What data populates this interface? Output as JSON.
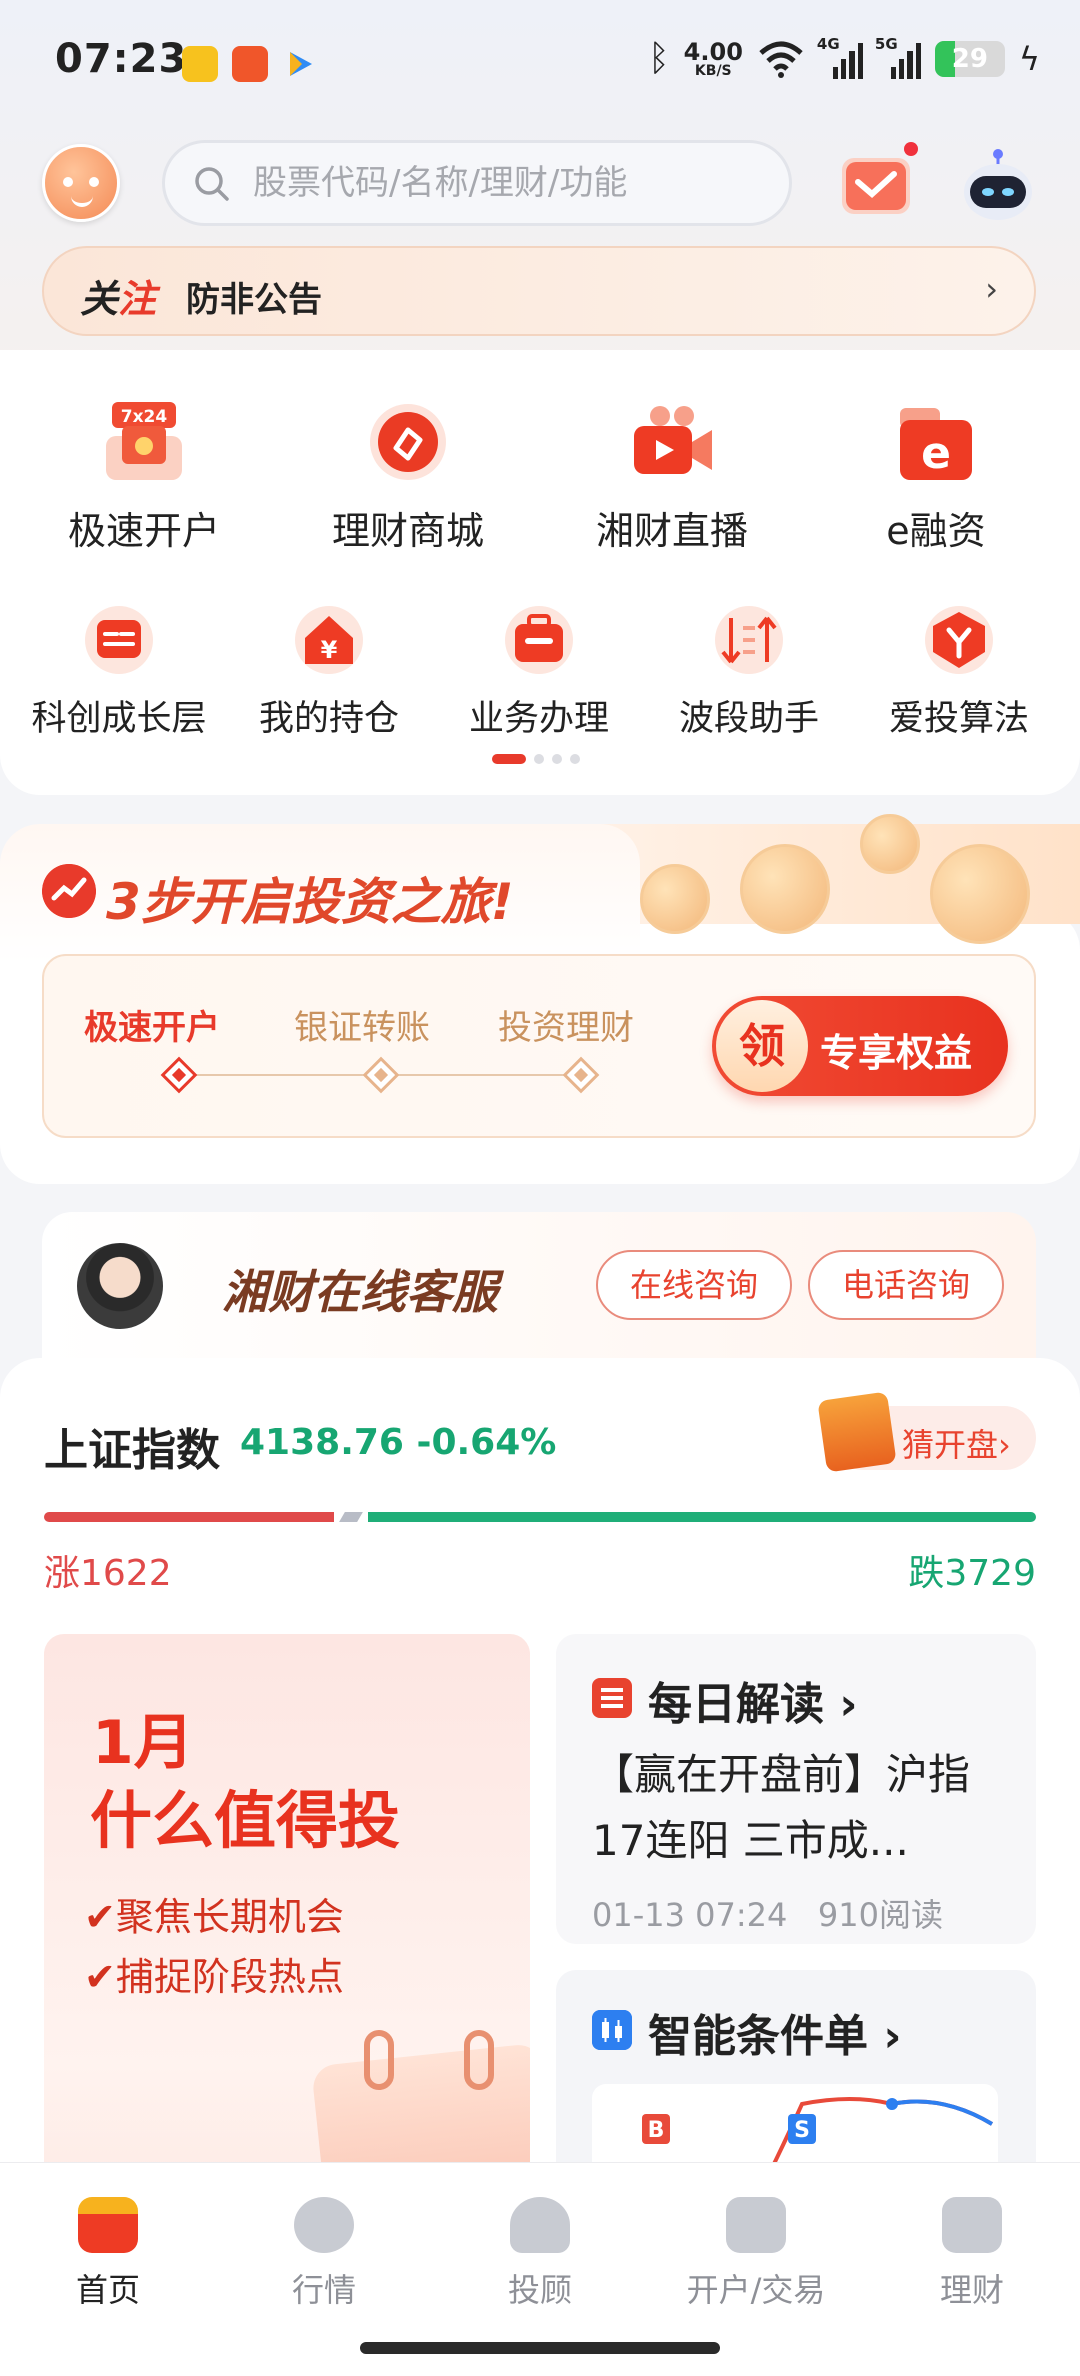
{
  "status_bar": {
    "time": "07:23",
    "speed_value": "4.00",
    "speed_unit": "KB/S",
    "signal_1": "4G",
    "signal_2": "5G",
    "battery": "29"
  },
  "header": {
    "search_placeholder": "股票代码/名称/理财/功能"
  },
  "notice": {
    "tag_part1": "关",
    "tag_part2": "注",
    "text": "防非公告",
    "arrow": "›"
  },
  "menu_row1": [
    {
      "label": "极速开户",
      "icon": "account-open-icon",
      "badge": "7x24"
    },
    {
      "label": "理财商城",
      "icon": "wealth-mall-icon"
    },
    {
      "label": "湘财直播",
      "icon": "live-video-icon"
    },
    {
      "label": "e融资",
      "icon": "e-finance-icon"
    }
  ],
  "menu_row2": [
    {
      "label": "科创成长层",
      "icon": "growth-board-icon"
    },
    {
      "label": "我的持仓",
      "icon": "holdings-icon"
    },
    {
      "label": "业务办理",
      "icon": "briefcase-icon"
    },
    {
      "label": "波段助手",
      "icon": "swing-helper-icon"
    },
    {
      "label": "爱投算法",
      "icon": "algo-icon"
    }
  ],
  "journey": {
    "title": "3步开启投资之旅!",
    "steps": [
      "极速开户",
      "银证转账",
      "投资理财"
    ],
    "perk_icon": "领",
    "perk_label": "专享权益"
  },
  "service": {
    "title": "湘财在线客服",
    "btn_online": "在线咨询",
    "btn_phone": "电话咨询"
  },
  "market": {
    "index_name": "上证指数",
    "index_value": "4138.76",
    "index_change": "-0.64%",
    "guess_label": "猜开盘",
    "up_label": "涨1622",
    "down_label": "跌3729",
    "up_count": 1622,
    "down_count": 3729
  },
  "promo": {
    "line1": "1月",
    "line2": "什么值得投",
    "bullet1": "聚焦长期机会",
    "bullet2": "捕捉阶段热点"
  },
  "news": {
    "title": "每日解读",
    "body": "【赢在开盘前】沪指17连阳 三市成...",
    "date": "01-13 07:24",
    "reads": "910阅读"
  },
  "condition_order": {
    "title": "智能条件单",
    "buy_tag": "B",
    "sell_tag": "S"
  },
  "nav": [
    {
      "label": "首页",
      "icon": "home-icon",
      "active": true
    },
    {
      "label": "行情",
      "icon": "market-icon",
      "active": false
    },
    {
      "label": "投顾",
      "icon": "advisor-icon",
      "active": false
    },
    {
      "label": "开户/交易",
      "icon": "trade-icon",
      "active": false
    },
    {
      "label": "理财",
      "icon": "wallet-icon",
      "active": false
    }
  ],
  "colors": {
    "accent": "#e8321f",
    "up": "#e04a4a",
    "down": "#17a672"
  }
}
